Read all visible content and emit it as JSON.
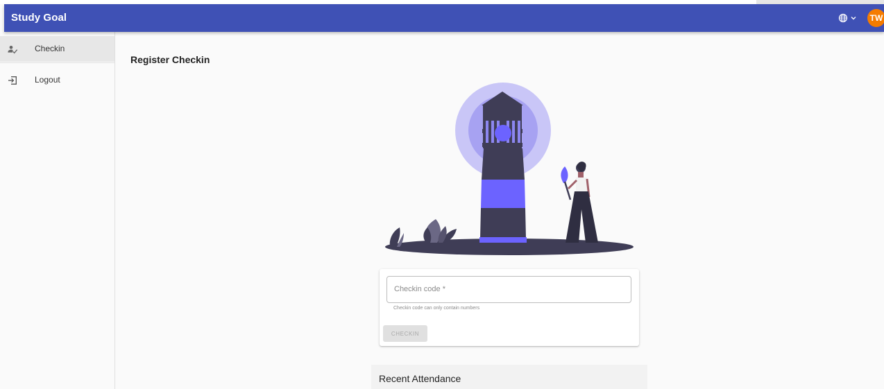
{
  "app": {
    "title": "Study Goal"
  },
  "header": {
    "language_icon": "globe-icon",
    "language_chevron": "chevron-down-icon",
    "avatar_initials": "TW",
    "avatar_color": "#f57c00",
    "bar_color": "#3f51b5"
  },
  "sidebar": {
    "items": [
      {
        "label": "Checkin",
        "icon": "person-check-icon",
        "active": true
      },
      {
        "label": "Logout",
        "icon": "logout-icon",
        "active": false
      }
    ]
  },
  "main": {
    "page_title": "Register Checkin",
    "illustration": "lighthouse-illustration",
    "form": {
      "checkin_placeholder": "Checkin code *",
      "checkin_value": "",
      "hint": "Checkin code can only contain numbers",
      "submit_label": "CHECKIN",
      "submit_disabled": true
    },
    "recent_attendance_title": "Recent Attendance"
  }
}
